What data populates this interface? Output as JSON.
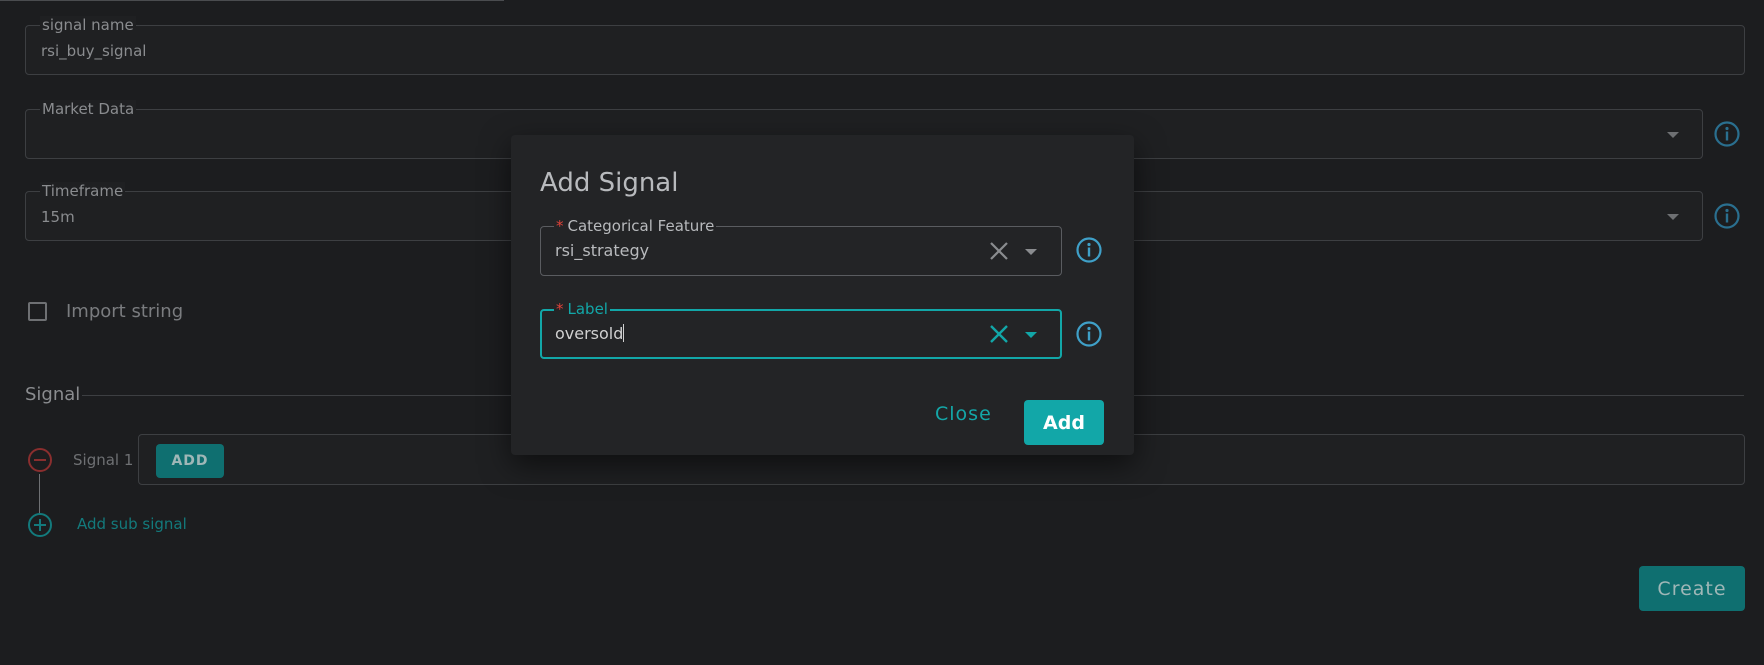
{
  "form": {
    "signal_name": {
      "label": "signal name",
      "value": "rsi_buy_signal"
    },
    "market_data": {
      "label": "Market Data",
      "value": ""
    },
    "timeframe": {
      "label": "Timeframe",
      "value": "15m"
    },
    "import_string": {
      "label": "Import string",
      "checked": false
    },
    "signal_section": {
      "title": "Signal",
      "signal_label": "Signal 1",
      "add_button": "ADD",
      "add_sub_signal": "Add sub signal"
    },
    "create_button": "Create"
  },
  "modal": {
    "title": "Add Signal",
    "categorical_feature": {
      "required_mark": "*",
      "label": "Categorical Feature",
      "value": "rsi_strategy"
    },
    "label_field": {
      "required_mark": "*",
      "label": "Label",
      "value": "oversold"
    },
    "close_button": "Close",
    "add_button": "Add"
  },
  "colors": {
    "accent": "#12a7a8",
    "background": "#1c1d1f",
    "danger": "#e0433a"
  },
  "icons": [
    "info-icon",
    "close-icon",
    "chevron-down-icon",
    "remove-circle-icon",
    "add-circle-icon"
  ]
}
